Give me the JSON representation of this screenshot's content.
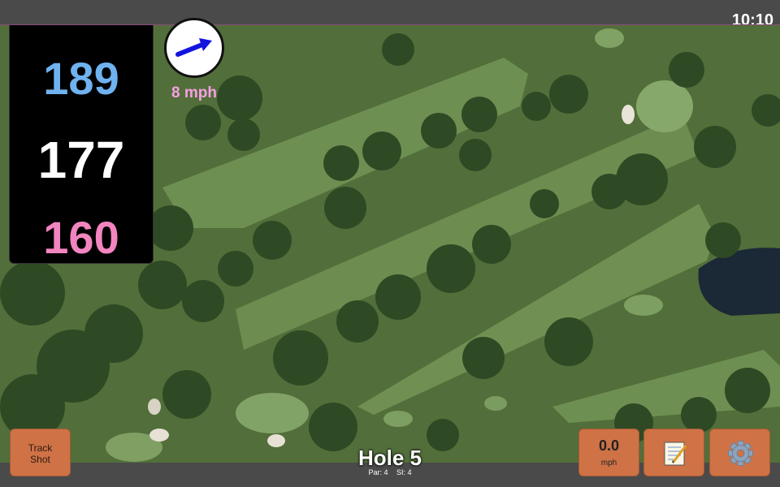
{
  "clock": "10:10",
  "distances": {
    "back": "189",
    "middle": "177",
    "front": "160"
  },
  "wind": {
    "speed": "8 mph",
    "arrow_icon": "wind-arrow-icon"
  },
  "track_shot": {
    "line1": "Track",
    "line2": "Shot"
  },
  "speed": {
    "value": "0.0",
    "unit": "mph"
  },
  "hole": {
    "title": "Hole 5",
    "par": "Par: 4",
    "si": "SI: 4"
  },
  "icons": {
    "notes": "notepad-icon",
    "settings": "gear-icon"
  },
  "colors": {
    "back": "#6fb2ef",
    "middle": "#ffffff",
    "front": "#f285c0",
    "wind_text": "#f6a0e4",
    "button": "#cf7246"
  }
}
